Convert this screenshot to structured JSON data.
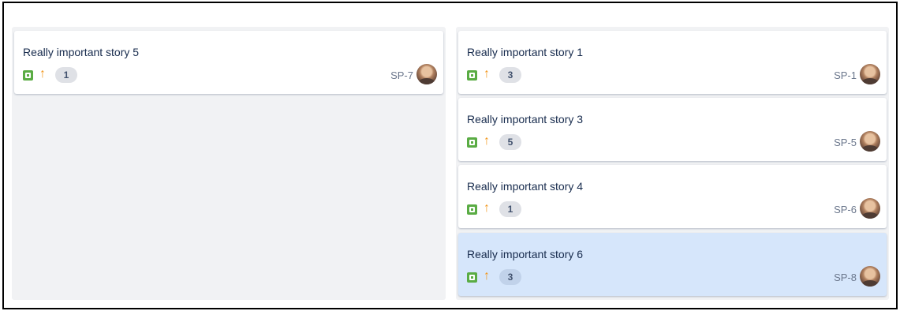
{
  "columns": [
    {
      "cards": [
        {
          "title": "Really important story 5",
          "points": "1",
          "key": "SP-7",
          "priority_icon": "arrow-up-icon",
          "type_icon": "story-icon",
          "selected": false
        }
      ]
    },
    {
      "cards": [
        {
          "title": "Really important story 1",
          "points": "3",
          "key": "SP-1",
          "priority_icon": "arrow-up-icon",
          "type_icon": "story-icon",
          "selected": false
        },
        {
          "title": "Really important story 3",
          "points": "5",
          "key": "SP-5",
          "priority_icon": "arrow-up-icon",
          "type_icon": "story-icon",
          "selected": false
        },
        {
          "title": "Really important story 4",
          "points": "1",
          "key": "SP-6",
          "priority_icon": "arrow-up-icon",
          "type_icon": "story-icon",
          "selected": false
        },
        {
          "title": "Really important story 6",
          "points": "3",
          "key": "SP-8",
          "priority_icon": "arrow-up-icon",
          "type_icon": "story-icon",
          "selected": true
        }
      ]
    }
  ],
  "colors": {
    "column_background": "#f1f2f4",
    "card_background": "#ffffff",
    "selected_card_background": "#d6e6fb",
    "story_green": "#5aac44",
    "priority_orange": "#f2961b"
  }
}
